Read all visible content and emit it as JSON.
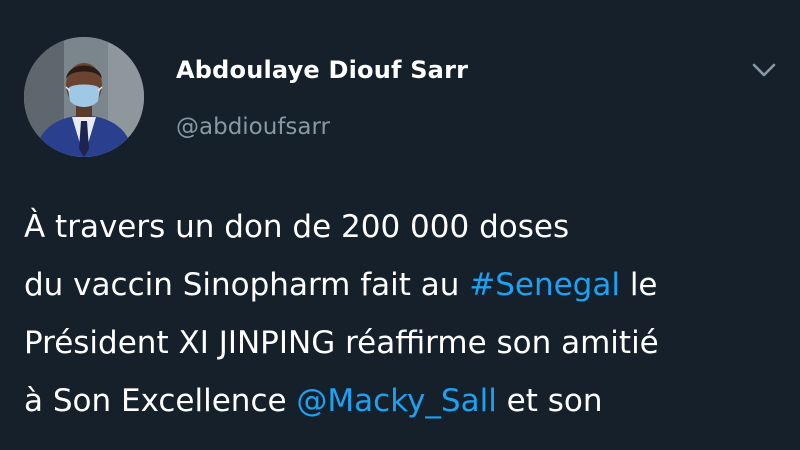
{
  "tweet": {
    "author": {
      "display_name": "Abdoulaye Diouf Sarr",
      "handle": "@abdioufsarr",
      "avatar": "profile-photo-icon"
    },
    "menu_icon": "chevron-down-icon",
    "body_lines": [
      {
        "text": "À travers un don de 200 000 doses"
      },
      {
        "before": "du vaccin Sinopharm fait au ",
        "hashtag": "#Senegal",
        "after": " le"
      },
      {
        "text": "Président XI JINPING réaffirme son amitié"
      },
      {
        "before": "à Son Excellence ",
        "mention": "@Macky_Sall",
        "after": " et son"
      }
    ]
  },
  "colors": {
    "background": "#15202b",
    "text": "#ffffff",
    "muted": "#8899a6",
    "link": "#1da1f2"
  }
}
